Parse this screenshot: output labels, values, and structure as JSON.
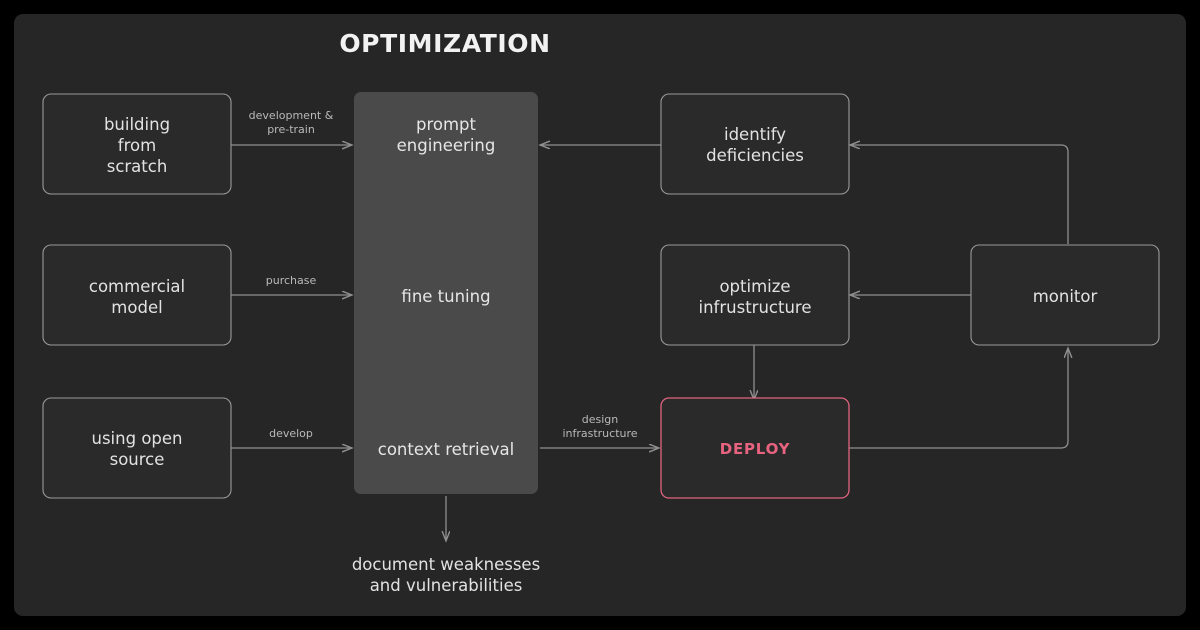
{
  "page": {
    "title": "OPTIMIZATION",
    "background_color": "#000000",
    "board_color": "#262626"
  },
  "colors": {
    "box_border": "#9a9a9a",
    "box_fill": "#2a2a2a",
    "panel_fill": "#4a4a4a",
    "edge": "#8f8f8f",
    "text": "#e2e2e2",
    "accent": "#e8637f",
    "accent_border": "#e0647f"
  },
  "sources": [
    {
      "id": "building-from-scratch",
      "label": "building\nfrom\nscratch",
      "line1": "building",
      "line2": "from",
      "line3": "scratch"
    },
    {
      "id": "commercial-model",
      "label": "commercial\nmodel",
      "line1": "commercial",
      "line2": "model"
    },
    {
      "id": "using-open-source",
      "label": "using open\nsource",
      "line1": "using open",
      "line2": "source"
    }
  ],
  "panel": {
    "id": "optimization-panel",
    "items": [
      {
        "id": "prompt-engineering",
        "line1": "prompt",
        "line2": "engineering"
      },
      {
        "id": "fine-tuning",
        "line1": "fine tuning",
        "line2": ""
      },
      {
        "id": "context-retrieval",
        "line1": "context retrieval",
        "line2": ""
      }
    ]
  },
  "right_nodes": [
    {
      "id": "identify-deficiencies",
      "line1": "identify",
      "line2": "deficiencies"
    },
    {
      "id": "optimize-infrustructure",
      "line1": "optimize",
      "line2": "infrustructure"
    },
    {
      "id": "deploy",
      "line1": "DEPLOY",
      "line2": ""
    },
    {
      "id": "monitor",
      "line1": "monitor",
      "line2": ""
    }
  ],
  "edge_labels": [
    {
      "id": "development-pre-train",
      "line1": "development &",
      "line2": "pre-train"
    },
    {
      "id": "purchase",
      "line1": "purchase",
      "line2": ""
    },
    {
      "id": "develop",
      "line1": "develop",
      "line2": ""
    },
    {
      "id": "design-infrastructure",
      "line1": "design",
      "line2": "infrastructure"
    }
  ],
  "free_text": {
    "id": "document-weaknesses",
    "line1": "document weaknesses",
    "line2": "and vulnerabilities"
  }
}
